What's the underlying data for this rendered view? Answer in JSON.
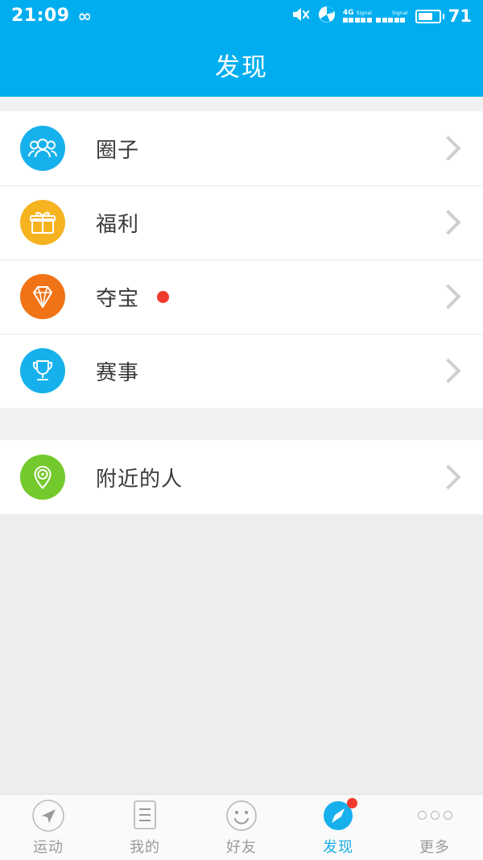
{
  "status_bar": {
    "time": "21:09",
    "infinity_icon": "infinity-icon",
    "mute_icon": "mute-icon",
    "wifi_icon": "wifi-icon",
    "network_type": "4G",
    "signal_label_1": "Signal",
    "signal_label_2": "Signal",
    "battery_icon": "battery-icon",
    "battery_percent": "71",
    "battery_level": 71
  },
  "header": {
    "title": "发现"
  },
  "list_groups": [
    {
      "items": [
        {
          "label": "圈子",
          "icon": "group-people-icon",
          "icon_color": "#16b1ec",
          "badge": false,
          "chevron": "chevron-right-icon"
        },
        {
          "label": "福利",
          "icon": "gift-box-icon",
          "icon_color": "#f5b320",
          "badge": false,
          "chevron": "chevron-right-icon"
        },
        {
          "label": "夺宝",
          "icon": "diamond-icon",
          "icon_color": "#f07316",
          "badge": true,
          "badge_color": "#f03b2c",
          "chevron": "chevron-right-icon"
        },
        {
          "label": "赛事",
          "icon": "trophy-icon",
          "icon_color": "#16b1ec",
          "badge": false,
          "chevron": "chevron-right-icon"
        }
      ]
    },
    {
      "items": [
        {
          "label": "附近的人",
          "icon": "location-pin-icon",
          "icon_color": "#74c92c",
          "badge": false,
          "chevron": "chevron-right-icon"
        }
      ]
    }
  ],
  "bottom_nav": {
    "active_index": 3,
    "items": [
      {
        "label": "运动",
        "icon": "compass-outline-icon",
        "active": false,
        "badge": false
      },
      {
        "label": "我的",
        "icon": "document-lines-icon",
        "active": false,
        "badge": false
      },
      {
        "label": "好友",
        "icon": "smiley-face-icon",
        "active": false,
        "badge": false
      },
      {
        "label": "发现",
        "icon": "compass-filled-icon",
        "active": true,
        "badge": true
      },
      {
        "label": "更多",
        "icon": "three-dots-icon",
        "active": false,
        "badge": false
      }
    ]
  },
  "colors": {
    "brand_blue": "#00aef0",
    "accent_blue": "#1aade4",
    "badge_red": "#f03b2c",
    "page_bg": "#eceded",
    "card_bg": "#ffffff",
    "text_primary": "#3a3a3a",
    "text_muted": "#9a9a9a"
  }
}
